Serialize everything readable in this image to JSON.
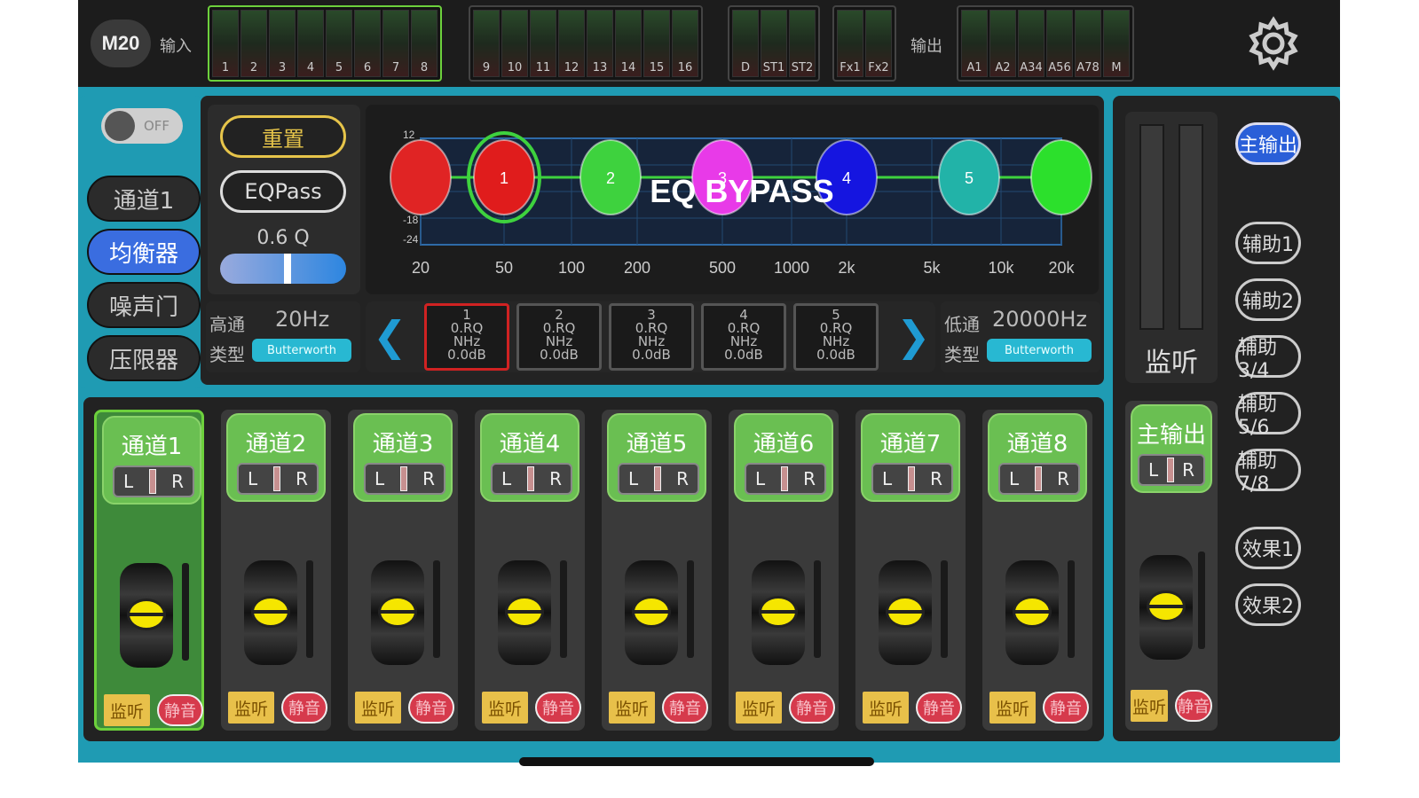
{
  "topbar": {
    "brand": "M20",
    "input_label": "输入",
    "output_label": "输出",
    "input_groups": [
      [
        "1",
        "2",
        "3",
        "4",
        "5",
        "6",
        "7",
        "8"
      ],
      [
        "9",
        "10",
        "11",
        "12",
        "13",
        "14",
        "15",
        "16"
      ],
      [
        "D",
        "ST1",
        "ST2"
      ],
      [
        "Fx1",
        "Fx2"
      ]
    ],
    "output_meters": [
      "A1",
      "A2",
      "A34",
      "A56",
      "A78",
      "M"
    ]
  },
  "left_nav": {
    "toggle_label": "OFF",
    "items": [
      "通道1",
      "均衡器",
      "噪声门",
      "压限器"
    ],
    "active_index": 1
  },
  "eq": {
    "reset_label": "重置",
    "eqpass_label": "EQPass",
    "q_label": "0.6 Q",
    "q_value_fraction": 0.55,
    "bypass_text": "EQ BYPASS",
    "db_ticks": [
      "12",
      "-18",
      "-24"
    ],
    "freq_ticks": [
      "20",
      "50",
      "100",
      "200",
      "500",
      "1000",
      "2k",
      "5k",
      "10k",
      "20k"
    ],
    "nodes": [
      {
        "label": "",
        "color": "#e02424"
      },
      {
        "label": "1",
        "color": "#e01c1c"
      },
      {
        "label": "2",
        "color": "#3ed23e"
      },
      {
        "label": "3",
        "color": "#e83ae8"
      },
      {
        "label": "4",
        "color": "#1515e0"
      },
      {
        "label": "5",
        "color": "#22b3a8"
      },
      {
        "label": "",
        "color": "#2ce02c"
      }
    ],
    "bands": [
      {
        "num": "1",
        "line1": "0.RQ",
        "line2": "NHz",
        "line3": "0.0dB"
      },
      {
        "num": "2",
        "line1": "0.RQ",
        "line2": "NHz",
        "line3": "0.0dB"
      },
      {
        "num": "3",
        "line1": "0.RQ",
        "line2": "NHz",
        "line3": "0.0dB"
      },
      {
        "num": "4",
        "line1": "0.RQ",
        "line2": "NHz",
        "line3": "0.0dB"
      },
      {
        "num": "5",
        "line1": "0.RQ",
        "line2": "NHz",
        "line3": "0.0dB"
      }
    ],
    "high_pass": {
      "label": "高通",
      "value": "20Hz",
      "type_label": "类型",
      "type_value": "Butterworth"
    },
    "low_pass": {
      "label": "低通",
      "value": "20000Hz",
      "type_label": "类型",
      "type_value": "Butterworth"
    }
  },
  "channels": [
    {
      "name": "通道1",
      "L": "L",
      "R": "R",
      "monitor": "监听",
      "mute": "静音"
    },
    {
      "name": "通道2",
      "L": "L",
      "R": "R",
      "monitor": "监听",
      "mute": "静音"
    },
    {
      "name": "通道3",
      "L": "L",
      "R": "R",
      "monitor": "监听",
      "mute": "静音"
    },
    {
      "name": "通道4",
      "L": "L",
      "R": "R",
      "monitor": "监听",
      "mute": "静音"
    },
    {
      "name": "通道5",
      "L": "L",
      "R": "R",
      "monitor": "监听",
      "mute": "静音"
    },
    {
      "name": "通道6",
      "L": "L",
      "R": "R",
      "monitor": "监听",
      "mute": "静音"
    },
    {
      "name": "通道7",
      "L": "L",
      "R": "R",
      "monitor": "监听",
      "mute": "静音"
    },
    {
      "name": "通道8",
      "L": "L",
      "R": "R",
      "monitor": "监听",
      "mute": "静音"
    }
  ],
  "master": {
    "name": "主输出",
    "L": "L",
    "R": "R",
    "monitor": "监听",
    "mute": "静音",
    "monitor_meter_label": "监听"
  },
  "buses": [
    "主输出",
    "辅助1",
    "辅助2",
    "辅助3/4",
    "辅助5/6",
    "辅助7/8",
    "效果1",
    "效果2"
  ],
  "colors": {
    "teal": "#1f9bb3",
    "green": "#6abf52",
    "active_blue": "#3a6de0"
  }
}
